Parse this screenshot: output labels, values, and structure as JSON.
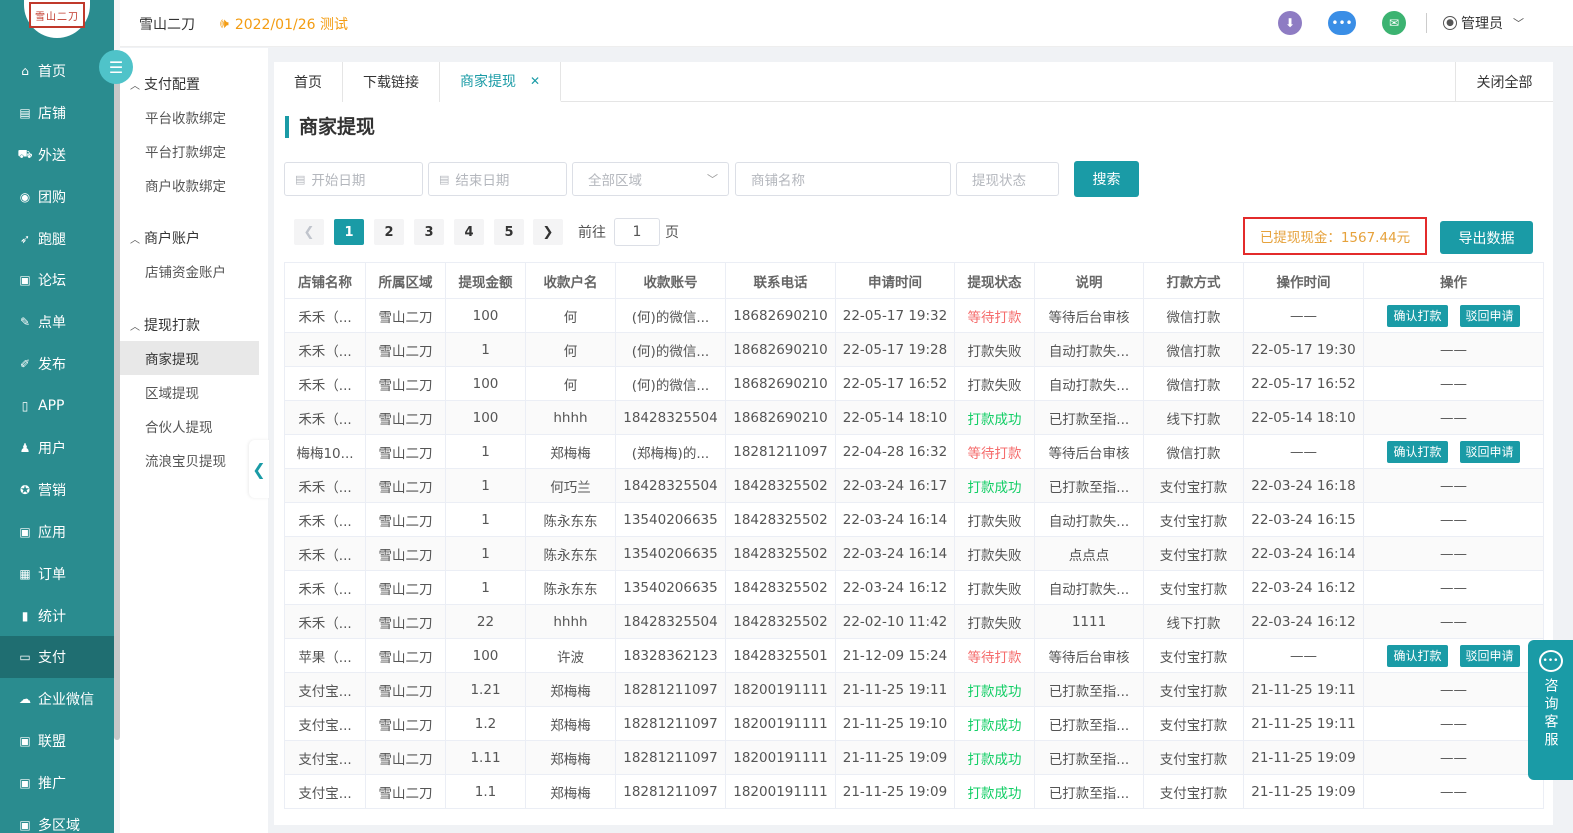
{
  "logo": {
    "text": "雪山二刀"
  },
  "header": {
    "brand": "雪山二刀",
    "notice": "2022/01/26 测试",
    "admin": "管理员"
  },
  "left_nav": [
    {
      "label": "首页",
      "icon": "home-icon",
      "glyph": "⌂"
    },
    {
      "label": "店铺",
      "icon": "shop-icon",
      "glyph": "▤"
    },
    {
      "label": "外送",
      "icon": "delivery-icon",
      "glyph": "⛟"
    },
    {
      "label": "团购",
      "icon": "group-buy-icon",
      "glyph": "◉"
    },
    {
      "label": "跑腿",
      "icon": "errand-icon",
      "glyph": "➶"
    },
    {
      "label": "论坛",
      "icon": "forum-icon",
      "glyph": "▣"
    },
    {
      "label": "点单",
      "icon": "order-menu-icon",
      "glyph": "✎"
    },
    {
      "label": "发布",
      "icon": "publish-icon",
      "glyph": "✐"
    },
    {
      "label": "APP",
      "icon": "app-icon",
      "glyph": "▯"
    },
    {
      "label": "用户",
      "icon": "user-icon",
      "glyph": "♟"
    },
    {
      "label": "营销",
      "icon": "marketing-icon",
      "glyph": "✪"
    },
    {
      "label": "应用",
      "icon": "apps-icon",
      "glyph": "▣"
    },
    {
      "label": "订单",
      "icon": "orders-icon",
      "glyph": "▦"
    },
    {
      "label": "统计",
      "icon": "stats-icon",
      "glyph": "▮"
    },
    {
      "label": "支付",
      "icon": "pay-icon",
      "glyph": "▭"
    },
    {
      "label": "企业微信",
      "icon": "wecom-icon",
      "glyph": "☁"
    },
    {
      "label": "联盟",
      "icon": "alliance-icon",
      "glyph": "▣"
    },
    {
      "label": "推广",
      "icon": "promote-icon",
      "glyph": "▣"
    },
    {
      "label": "多区域",
      "icon": "region-icon",
      "glyph": "▣"
    }
  ],
  "sub_nav": {
    "groups": [
      {
        "title": "支付配置",
        "items": [
          "平台收款绑定",
          "平台打款绑定",
          "商户收款绑定"
        ]
      },
      {
        "title": "商户账户",
        "items": [
          "店铺资金账户"
        ]
      },
      {
        "title": "提现打款",
        "items": [
          "商家提现",
          "区域提现",
          "合伙人提现",
          "流浪宝贝提现"
        ]
      }
    ]
  },
  "tabs": {
    "items": [
      "首页",
      "下载链接",
      "商家提现"
    ],
    "close_all": "关闭全部"
  },
  "page_title": "商家提现",
  "filters": {
    "start_date": "开始日期",
    "end_date": "结束日期",
    "region": "全部区域",
    "shop_name": "商铺名称",
    "status": "提现状态",
    "search_btn": "搜索"
  },
  "pagination": {
    "pages": [
      "1",
      "2",
      "3",
      "4",
      "5"
    ],
    "current": "1",
    "goto_prefix": "前往",
    "goto_value": "1",
    "goto_suffix": "页"
  },
  "total_withdrawn": "已提现现金：1567.44元",
  "export_btn": "导出数据",
  "table": {
    "headers": [
      "店铺名称",
      "所属区域",
      "提现金额",
      "收款户名",
      "收款账号",
      "联系电话",
      "申请时间",
      "提现状态",
      "说明",
      "打款方式",
      "操作时间",
      "操作"
    ],
    "op_confirm": "确认打款",
    "op_reject": "驳回申请",
    "rows": [
      [
        "禾禾（...",
        "雪山二刀",
        "100",
        "何",
        "(何)的微信...",
        "18682690210",
        "22-05-17 19:32",
        "等待打款",
        "等待后台审核",
        "微信打款",
        "——",
        "btn"
      ],
      [
        "禾禾（...",
        "雪山二刀",
        "1",
        "何",
        "(何)的微信...",
        "18682690210",
        "22-05-17 19:28",
        "打款失败",
        "自动打款失...",
        "微信打款",
        "22-05-17 19:30",
        "——"
      ],
      [
        "禾禾（...",
        "雪山二刀",
        "100",
        "何",
        "(何)的微信...",
        "18682690210",
        "22-05-17 16:52",
        "打款失败",
        "自动打款失...",
        "微信打款",
        "22-05-17 16:52",
        "——"
      ],
      [
        "禾禾（...",
        "雪山二刀",
        "100",
        "hhhh",
        "18428325504",
        "18682690210",
        "22-05-14 18:10",
        "打款成功",
        "已打款至指...",
        "线下打款",
        "22-05-14 18:10",
        "——"
      ],
      [
        "梅梅10...",
        "雪山二刀",
        "1",
        "郑梅梅",
        "(郑梅梅)的...",
        "18281211097",
        "22-04-28 16:32",
        "等待打款",
        "等待后台审核",
        "微信打款",
        "——",
        "btn"
      ],
      [
        "禾禾（...",
        "雪山二刀",
        "1",
        "何巧兰",
        "18428325504",
        "18428325502",
        "22-03-24 16:17",
        "打款成功",
        "已打款至指...",
        "支付宝打款",
        "22-03-24 16:18",
        "——"
      ],
      [
        "禾禾（...",
        "雪山二刀",
        "1",
        "陈永东东",
        "13540206635",
        "18428325502",
        "22-03-24 16:14",
        "打款失败",
        "自动打款失...",
        "支付宝打款",
        "22-03-24 16:15",
        "——"
      ],
      [
        "禾禾（...",
        "雪山二刀",
        "1",
        "陈永东东",
        "13540206635",
        "18428325502",
        "22-03-24 16:14",
        "打款失败",
        "点点点",
        "支付宝打款",
        "22-03-24 16:14",
        "——"
      ],
      [
        "禾禾（...",
        "雪山二刀",
        "1",
        "陈永东东",
        "13540206635",
        "18428325502",
        "22-03-24 16:12",
        "打款失败",
        "自动打款失...",
        "支付宝打款",
        "22-03-24 16:12",
        "——"
      ],
      [
        "禾禾（...",
        "雪山二刀",
        "22",
        "hhhh",
        "18428325504",
        "18428325502",
        "22-02-10 11:42",
        "打款失败",
        "1111",
        "线下打款",
        "22-03-24 16:12",
        "——"
      ],
      [
        "苹果（...",
        "雪山二刀",
        "100",
        "许波",
        "18328362123",
        "18428325501",
        "21-12-09 15:24",
        "等待打款",
        "等待后台审核",
        "支付宝打款",
        "——",
        "btn"
      ],
      [
        "支付宝...",
        "雪山二刀",
        "1.21",
        "郑梅梅",
        "18281211097",
        "18200191111",
        "21-11-25 19:11",
        "打款成功",
        "已打款至指...",
        "支付宝打款",
        "21-11-25 19:11",
        "——"
      ],
      [
        "支付宝...",
        "雪山二刀",
        "1.2",
        "郑梅梅",
        "18281211097",
        "18200191111",
        "21-11-25 19:10",
        "打款成功",
        "已打款至指...",
        "支付宝打款",
        "21-11-25 19:11",
        "——"
      ],
      [
        "支付宝...",
        "雪山二刀",
        "1.11",
        "郑梅梅",
        "18281211097",
        "18200191111",
        "21-11-25 19:09",
        "打款成功",
        "已打款至指...",
        "支付宝打款",
        "21-11-25 19:09",
        "——"
      ],
      [
        "支付宝...",
        "雪山二刀",
        "1.1",
        "郑梅梅",
        "18281211097",
        "18200191111",
        "21-11-25 19:09",
        "打款成功",
        "已打款至指...",
        "支付宝打款",
        "21-11-25 19:09",
        "——"
      ]
    ]
  },
  "consult": {
    "label": "咨询客服"
  },
  "colors": {
    "primary": "#1a9ba6",
    "nav_bg": "#2a8c8f",
    "wait": "#f56c6c",
    "success": "#13ce66",
    "notice": "#f39c12"
  }
}
